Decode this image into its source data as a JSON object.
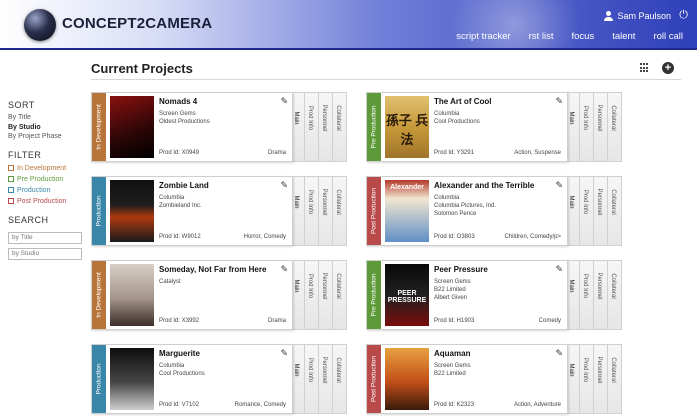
{
  "header": {
    "app_title": "CONCEPT2CAMERA",
    "user_name": "Sam Paulson",
    "nav": [
      "script tracker",
      "rst list",
      "focus",
      "talent",
      "roll call"
    ]
  },
  "sidebar": {
    "sort_heading": "SORT",
    "sort_items": [
      "By Title",
      "By Studio",
      "By Project Phase"
    ],
    "sort_active": "By Studio",
    "filter_heading": "FILTER",
    "filter_items": [
      {
        "label": "In Development",
        "color": "#b8753a"
      },
      {
        "label": "Pre Production",
        "color": "#5e9a3a"
      },
      {
        "label": "Production",
        "color": "#3a86a8"
      },
      {
        "label": "Post Production",
        "color": "#b84a4a"
      }
    ],
    "search_heading": "SEARCH",
    "search_title_placeholder": "by Title",
    "search_studio_placeholder": "by Studio"
  },
  "main": {
    "page_title": "Current Projects",
    "tabs": [
      "Main",
      "Prod Info",
      "Personnel",
      "Collateral"
    ]
  },
  "projects": [
    {
      "phase": "In Development",
      "phase_color": "#b8753a",
      "title": "Nomads 4",
      "lines": [
        "Screen Gems",
        "Oldest Productions"
      ],
      "prod_id": "Prod Id: X0949",
      "genre": "Drama",
      "poster": "pst-1",
      "poster_text": ""
    },
    {
      "phase": "Pre Production",
      "phase_color": "#5e9a3a",
      "title": "The Art of Cool",
      "lines": [
        "Columbia",
        "Cool Productions"
      ],
      "prod_id": "Prod Id: Y3291",
      "genre": "Action, Suspense",
      "poster": "pst-2",
      "poster_text": "孫子 兵法"
    },
    {
      "phase": "Production",
      "phase_color": "#3a86a8",
      "title": "Zombie Land",
      "lines": [
        "Columbia",
        "Zombieland Inc."
      ],
      "prod_id": "Prod Id: W9012",
      "genre": "Horror, Comedy",
      "poster": "pst-3",
      "poster_text": ""
    },
    {
      "phase": "Post Production",
      "phase_color": "#b84a4a",
      "title": "Alexander and the Terrible",
      "lines": [
        "Columbia",
        "Columbia Pictures, Ind.",
        "Solomon Pence"
      ],
      "prod_id": "Prod Id: O3803",
      "genre": "Children, Comedy/p>",
      "poster": "pst-4",
      "poster_text": "Alexander"
    },
    {
      "phase": "In Development",
      "phase_color": "#b8753a",
      "title": "Someday, Not Far from Here",
      "lines": [
        "Catalyst"
      ],
      "prod_id": "Prod Id: X3992",
      "genre": "Drama",
      "poster": "pst-5",
      "poster_text": ""
    },
    {
      "phase": "Pre Production",
      "phase_color": "#5e9a3a",
      "title": "Peer Pressure",
      "lines": [
        "Screen Gems",
        "B22 Limited",
        "Albert Given"
      ],
      "prod_id": "Prod Id: H1903",
      "genre": "Comedy",
      "poster": "pst-6",
      "poster_text": "PEER PRESSURE"
    },
    {
      "phase": "Production",
      "phase_color": "#3a86a8",
      "title": "Marguerite",
      "lines": [
        "Columbia",
        "Cool Productions"
      ],
      "prod_id": "Prod Id: V7102",
      "genre": "Romance, Comedy",
      "poster": "pst-7",
      "poster_text": ""
    },
    {
      "phase": "Post Production",
      "phase_color": "#b84a4a",
      "title": "Aquaman",
      "lines": [
        "Screen Gems",
        "B22 Limited"
      ],
      "prod_id": "Prod Id: K2323",
      "genre": "Action, Adventure",
      "poster": "pst-8",
      "poster_text": ""
    }
  ],
  "colors": {
    "header_dark": "#1d2a8e",
    "in_development": "#b8753a",
    "pre_production": "#5e9a3a",
    "production": "#3a86a8",
    "post_production": "#b84a4a"
  }
}
